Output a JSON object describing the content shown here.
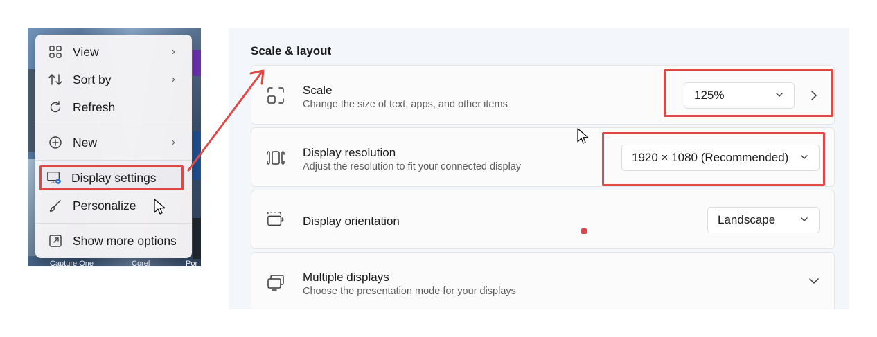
{
  "desktop": {
    "labels": [
      "Capture One",
      "Corel",
      "Por"
    ]
  },
  "context_menu": {
    "items": [
      {
        "label": "View",
        "icon": "grid-icon",
        "has_submenu": true
      },
      {
        "label": "Sort by",
        "icon": "sort-icon",
        "has_submenu": true
      },
      {
        "label": "Refresh",
        "icon": "refresh-icon",
        "has_submenu": false
      },
      {
        "label": "New",
        "icon": "plus-circle-icon",
        "has_submenu": true
      },
      {
        "label": "Display settings",
        "icon": "display-settings-icon",
        "has_submenu": false,
        "highlighted": true
      },
      {
        "label": "Personalize",
        "icon": "brush-icon",
        "has_submenu": false
      },
      {
        "label": "Show more options",
        "icon": "external-icon",
        "has_submenu": false
      }
    ]
  },
  "settings": {
    "section_title": "Scale & layout",
    "scale": {
      "title": "Scale",
      "description": "Change the size of text, apps, and other items",
      "value": "125%"
    },
    "resolution": {
      "title": "Display resolution",
      "description": "Adjust the resolution to fit your connected display",
      "value": "1920 × 1080 (Recommended)"
    },
    "orientation": {
      "title": "Display orientation",
      "value": "Landscape"
    },
    "multiple_displays": {
      "title": "Multiple displays",
      "description": "Choose the presentation mode for your displays"
    }
  },
  "colors": {
    "annotation_red": "#e04848",
    "panel_background": "#f3f6fb",
    "card_background": "#fbfbfb"
  }
}
